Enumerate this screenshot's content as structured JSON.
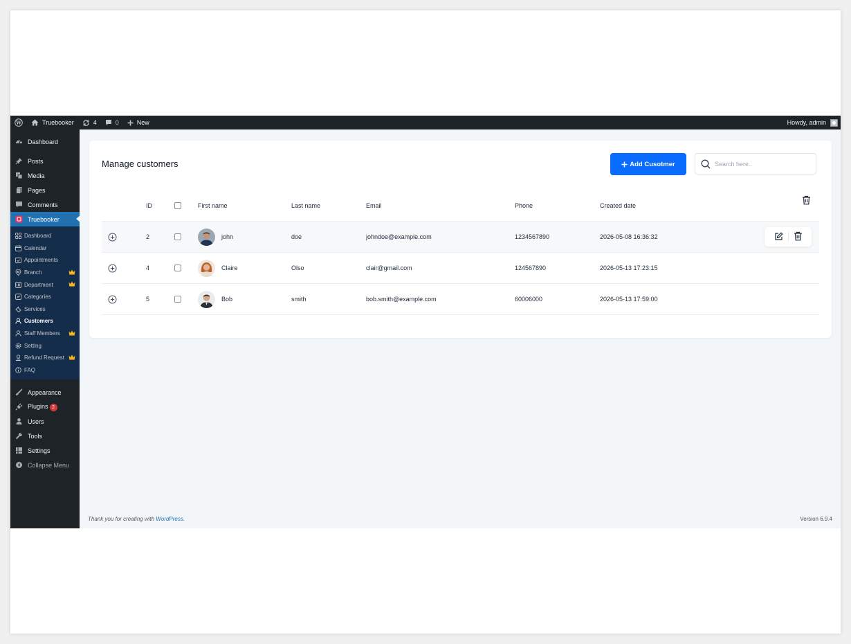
{
  "adminbar": {
    "site_name": "Truebooker",
    "updates_count": "4",
    "comments_count": "0",
    "new_label": "New",
    "howdy": "Howdy, admin"
  },
  "sidebar": {
    "top_items": [
      {
        "label": "Dashboard",
        "icon": "dashboard-icon"
      },
      {
        "label": "Posts",
        "icon": "pin-icon"
      },
      {
        "label": "Media",
        "icon": "media-icon"
      },
      {
        "label": "Pages",
        "icon": "pages-icon"
      },
      {
        "label": "Comments",
        "icon": "comment-icon"
      },
      {
        "label": "Truebooker",
        "icon": "truebooker-icon"
      }
    ],
    "submenu": [
      {
        "label": "Dashboard",
        "icon": "grid-icon",
        "pro": false
      },
      {
        "label": "Calendar",
        "icon": "calendar-icon",
        "pro": false
      },
      {
        "label": "Appointments",
        "icon": "appointment-icon",
        "pro": false
      },
      {
        "label": "Branch",
        "icon": "location-icon",
        "pro": true
      },
      {
        "label": "Department",
        "icon": "department-icon",
        "pro": true
      },
      {
        "label": "Categories",
        "icon": "category-icon",
        "pro": false
      },
      {
        "label": "Services",
        "icon": "services-icon",
        "pro": false
      },
      {
        "label": "Customers",
        "icon": "user-icon",
        "pro": false
      },
      {
        "label": "Staff Members",
        "icon": "staff-icon",
        "pro": true
      },
      {
        "label": "Setting",
        "icon": "gear-icon",
        "pro": false
      },
      {
        "label": "Refund Request",
        "icon": "refund-icon",
        "pro": true
      },
      {
        "label": "FAQ",
        "icon": "info-icon",
        "pro": false
      }
    ],
    "bottom_items": [
      {
        "label": "Appearance",
        "icon": "brush-icon"
      },
      {
        "label": "Plugins",
        "icon": "plugin-icon",
        "badge": "2"
      },
      {
        "label": "Users",
        "icon": "users-icon"
      },
      {
        "label": "Tools",
        "icon": "wrench-icon"
      },
      {
        "label": "Settings",
        "icon": "settings-icon"
      }
    ],
    "collapse_label": "Collapse Menu"
  },
  "main": {
    "title": "Manage customers",
    "add_button": "Add Cusotmer",
    "search_placeholder": "Search here..",
    "columns": {
      "id": "ID",
      "first": "First name",
      "last": "Last name",
      "email": "Email",
      "phone": "Phone",
      "created": "Created date"
    },
    "rows": [
      {
        "id": "2",
        "first": "john",
        "last": "doe",
        "email": "johndoe@example.com",
        "phone": "1234567890",
        "created": "2026-05-08 16:36:32"
      },
      {
        "id": "4",
        "first": "Claire",
        "last": "Olso",
        "email": "clair@gmail.com",
        "phone": "124567890",
        "created": "2026-05-13 17:23:15"
      },
      {
        "id": "5",
        "first": "Bob",
        "last": "smith",
        "email": "bob.smith@example.com",
        "phone": "60006000",
        "created": "2026-05-13 17:59:00"
      }
    ]
  },
  "footer": {
    "thanks": "Thank you for creating with",
    "wp_link": "WordPress",
    "version": "Version 6.9.4"
  },
  "colors": {
    "accent": "#0a6cff",
    "admin_dark": "#1d2327",
    "wp_blue": "#2271b1",
    "submenu_bg": "#132d4a"
  }
}
